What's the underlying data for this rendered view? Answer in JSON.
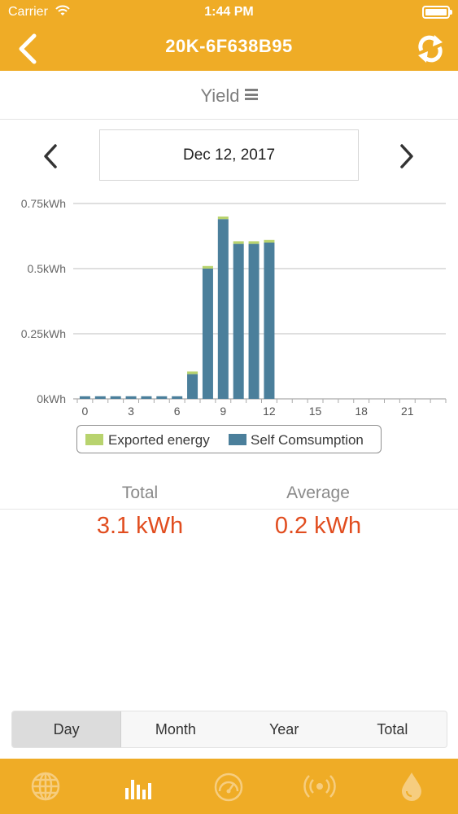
{
  "status_bar": {
    "carrier": "Carrier",
    "time": "1:44 PM"
  },
  "nav": {
    "title": "20K-6F638B95",
    "back_icon": "chevron-left-icon",
    "refresh_icon": "refresh-icon"
  },
  "yield_selector": {
    "label": "Yield",
    "icon": "menu-icon"
  },
  "date_picker": {
    "date": "Dec 12, 2017",
    "prev_icon": "chevron-left-icon",
    "next_icon": "chevron-right-icon"
  },
  "colors": {
    "accent": "#efac26",
    "self_consumption": "#4b7f9b",
    "exported": "#b8d36e",
    "value_text": "#e14d1f"
  },
  "chart_data": {
    "type": "bar",
    "stacked": true,
    "x": [
      0,
      1,
      2,
      3,
      4,
      5,
      6,
      7,
      8,
      9,
      10,
      11,
      12,
      13,
      14,
      15,
      16,
      17,
      18,
      19,
      20,
      21,
      22,
      23
    ],
    "x_tick_labels": [
      "0",
      "3",
      "6",
      "9",
      "12",
      "15",
      "18",
      "21"
    ],
    "y_tick_labels": [
      "0kWh",
      "0.25kWh",
      "0.5kWh",
      "0.75kWh"
    ],
    "ylim": [
      0,
      0.75
    ],
    "series": [
      {
        "name": "Self Comsumption",
        "values": [
          0.01,
          0.01,
          0.01,
          0.01,
          0.01,
          0.01,
          0.01,
          0.095,
          0.5,
          0.69,
          0.595,
          0.595,
          0.6,
          0,
          0,
          0,
          0,
          0,
          0,
          0,
          0,
          0,
          0,
          0
        ]
      },
      {
        "name": "Exported energy",
        "values": [
          0,
          0,
          0,
          0,
          0,
          0,
          0,
          0.01,
          0.01,
          0.01,
          0.01,
          0.01,
          0.01,
          0,
          0,
          0,
          0,
          0,
          0,
          0,
          0,
          0,
          0,
          0
        ]
      }
    ],
    "legend": [
      "Exported energy",
      "Self Comsumption"
    ],
    "grid": true
  },
  "summary": {
    "total_label": "Total",
    "total_value": "3.1 kWh",
    "average_label": "Average",
    "average_value": "0.2 kWh"
  },
  "period_tabs": [
    {
      "label": "Day",
      "active": true
    },
    {
      "label": "Month",
      "active": false
    },
    {
      "label": "Year",
      "active": false
    },
    {
      "label": "Total",
      "active": false
    }
  ],
  "tab_bar": [
    "globe-icon",
    "bar-chart-icon",
    "gauge-icon",
    "signal-icon",
    "drop-icon"
  ]
}
